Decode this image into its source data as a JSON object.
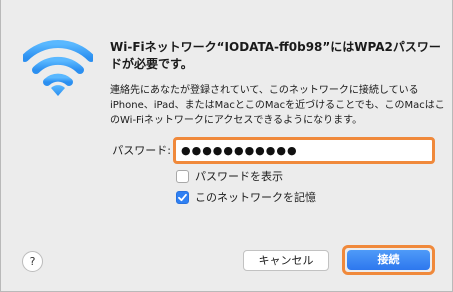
{
  "dialog": {
    "title": "Wi-Fiネットワーク“IODATA-ff0b98”にはWPA2パスワードが必要です。",
    "description": "連絡先にあなたが登録されていて、このネットワークに接続しているiPhone、iPad、またはMacとこのMacを近づけることでも、このMacはこのWi-Fiネットワークにアクセスできるようになります。"
  },
  "password": {
    "label": "パスワード:",
    "value": "●●●●●●●●●●●"
  },
  "options": {
    "show_password_label": "パスワードを表示",
    "show_password_checked": false,
    "remember_label": "このネットワークを記憶",
    "remember_checked": true
  },
  "buttons": {
    "help_label": "?",
    "cancel_label": "キャンセル",
    "connect_label": "接続"
  },
  "colors": {
    "accent": "#2f80f3",
    "focus_ring": "#f0893b",
    "wifi_icon": "#3a9df3"
  },
  "icons": {
    "wifi": "wifi-icon",
    "check": "checkmark-icon"
  }
}
